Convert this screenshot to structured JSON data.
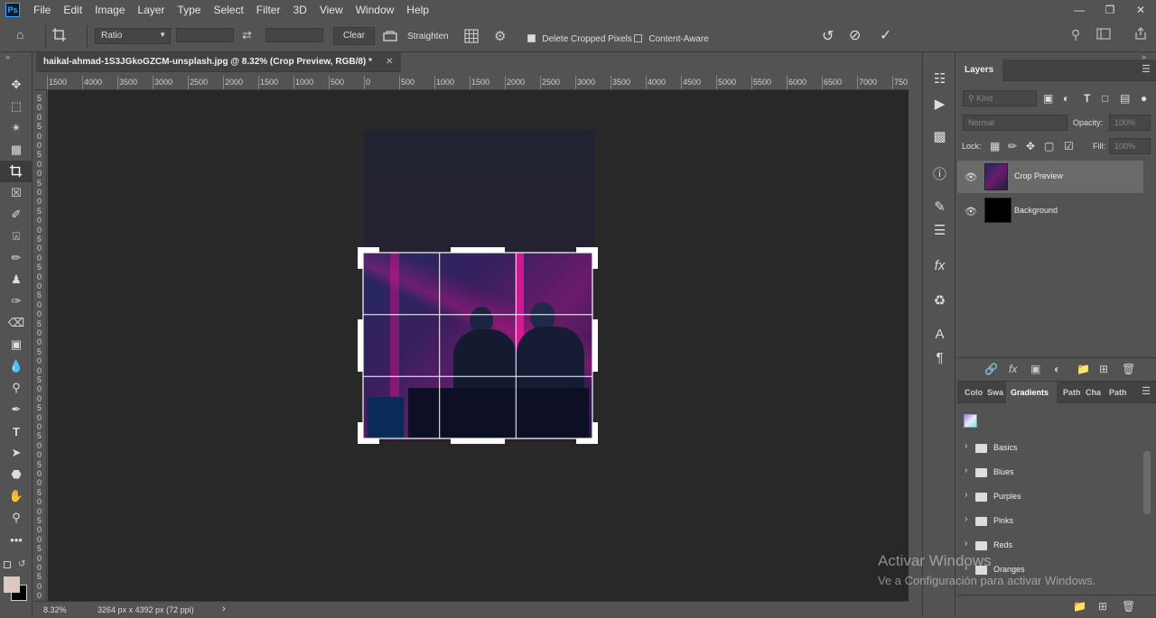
{
  "app": {
    "logo": "Ps"
  },
  "menu": [
    "File",
    "Edit",
    "Image",
    "Layer",
    "Type",
    "Select",
    "Filter",
    "3D",
    "View",
    "Window",
    "Help"
  ],
  "window_controls": [
    "minimize",
    "restore",
    "close"
  ],
  "options_bar": {
    "ratio": "Ratio",
    "clear_label": "Clear",
    "straighten_label": "Straighten",
    "delete_cropped_label": "Delete Cropped Pixels",
    "delete_cropped_checked": true,
    "content_aware_label": "Content-Aware",
    "content_aware_checked": false
  },
  "document": {
    "tab_title": "haikal-ahmad-1S3JGkoGZCM-unsplash.jpg @ 8.32% (Crop Preview, RGB/8) *",
    "zoom": "8.32%",
    "info": "3264 px x 4392 px (72 ppi)"
  },
  "ruler": {
    "top_labels": [
      "1500",
      "4000",
      "3500",
      "3000",
      "2500",
      "2000",
      "1500",
      "1000",
      "500",
      "0",
      "500",
      "1000",
      "1500",
      "2000",
      "2500",
      "3000",
      "3500",
      "4000",
      "4500",
      "5000",
      "5500",
      "6000",
      "6500",
      "7000",
      "750"
    ]
  },
  "layers_panel": {
    "title": "Layers",
    "kind_placeholder": "Kind",
    "blend_mode": "Normal",
    "opacity_label": "Opacity:",
    "opacity_value": "100%",
    "lock_label": "Lock:",
    "fill_label": "Fill:",
    "fill_value": "100%",
    "layers": [
      {
        "name": "Crop Preview",
        "selected": true
      },
      {
        "name": "Background",
        "selected": false
      }
    ]
  },
  "gradients_panel": {
    "tabs": [
      "Colo",
      "Swa",
      "Gradients",
      "Path",
      "Cha",
      "Path"
    ],
    "active_tab": "Gradients",
    "folders": [
      "Basics",
      "Blues",
      "Purples",
      "Pinks",
      "Reds",
      "Oranges"
    ]
  },
  "watermark": {
    "line1": "Activar Windows",
    "line2": "Ve a Configuración para activar Windows."
  },
  "colors": {
    "ui_bg": "#535353",
    "canvas_bg": "#282828",
    "accent": "#31a8ff",
    "foreground_swatch": "#e0c8c2",
    "background_swatch": "#000000"
  }
}
